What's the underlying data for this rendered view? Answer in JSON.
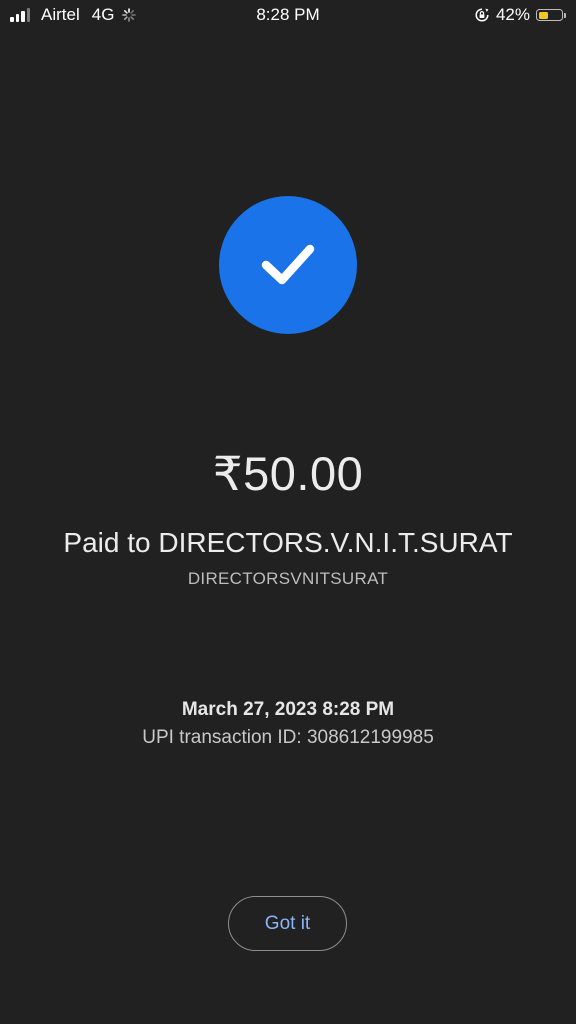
{
  "status_bar": {
    "carrier": "Airtel",
    "network": "4G",
    "time": "8:28 PM",
    "battery_percent": "42%",
    "battery_level": 0.42,
    "battery_color": "#f3c623",
    "icons": [
      "signal-icon",
      "loading-spinner-icon",
      "rotation-lock-icon",
      "battery-icon"
    ]
  },
  "payment": {
    "status_icon": "checkmark-icon",
    "accent_color": "#1a73e8",
    "amount": "₹50.00",
    "paid_to": "Paid to DIRECTORS.V.N.I.T.SURAT",
    "payee_id": "DIRECTORSVNITSURAT",
    "datetime": "March 27, 2023 8:28 PM",
    "upi_transaction": "UPI transaction ID: 308612199985"
  },
  "actions": {
    "got_it_label": "Got it",
    "got_it_color": "#8ab4f8"
  }
}
